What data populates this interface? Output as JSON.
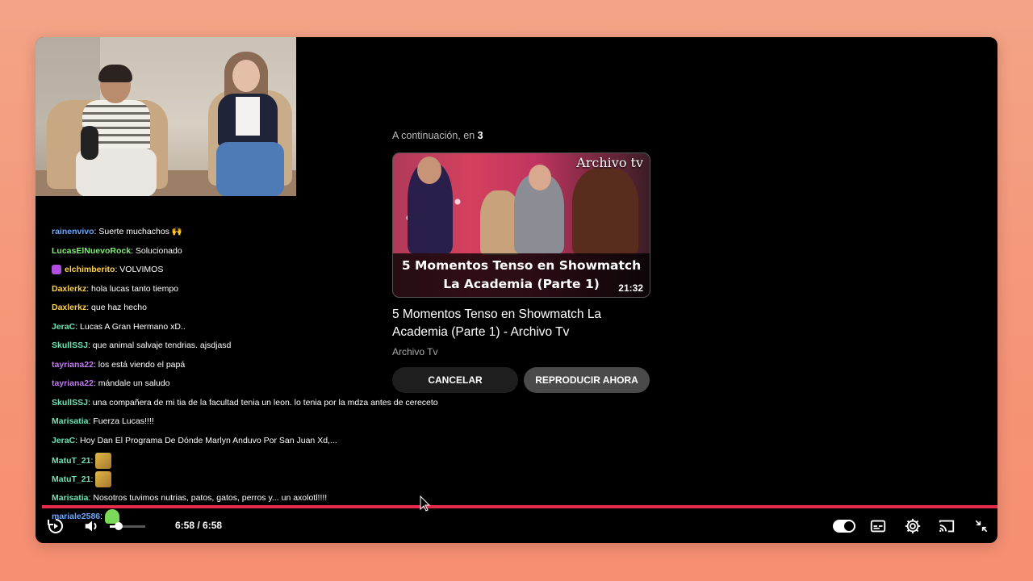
{
  "chat": [
    {
      "user": "rainenvivo",
      "color": "#6aa8ff",
      "msg": ": Suerte muchachos 🙌"
    },
    {
      "user": "LucasElNuevoRock",
      "color": "#7cf070",
      "msg": ": Solucionado"
    },
    {
      "user": "elchimberito",
      "color": "#ffd24d",
      "msg": ": VOLVIMOS",
      "badge": "mic"
    },
    {
      "user": "Daxlerkz",
      "color": "#ffd24d",
      "msg": ": hola lucas tanto tiempo"
    },
    {
      "user": "Daxlerkz",
      "color": "#ffd24d",
      "msg": ": que haz hecho"
    },
    {
      "user": "JeraC",
      "color": "#6fe3b2",
      "msg": ": Lucas A Gran Hermano xD.."
    },
    {
      "user": "SkullSSJ",
      "color": "#6fe3b2",
      "msg": ": que animal salvaje tendrias. ajsdjasd"
    },
    {
      "user": "tayriana22",
      "color": "#c07cf0",
      "msg": ": los está viendo el papá"
    },
    {
      "user": "tayriana22",
      "color": "#c07cf0",
      "msg": ": mándale un saludo"
    },
    {
      "user": "SkullSSJ",
      "color": "#6fe3b2",
      "msg": ": una compañera de mi tia de la facultad tenia un leon. lo tenia por la mdza antes de cereceto"
    },
    {
      "user": "Marisatia",
      "color": "#6fe3b2",
      "msg": ": Fuerza Lucas!!!!"
    },
    {
      "user": "JeraC",
      "color": "#6fe3b2",
      "msg": ": Hoy Dan El Programa De Dónde Marlyn Anduvo Por San Juan Xd,..."
    },
    {
      "user": "MatuT_21",
      "color": "#6fe3b2",
      "msg": ":",
      "emote": "gold"
    },
    {
      "user": "MatuT_21",
      "color": "#6fe3b2",
      "msg": ":",
      "emote": "gold"
    },
    {
      "user": "Marisatia",
      "color": "#6fe3b2",
      "msg": ": Nosotros tuvimos nutrias, patos, gatos, perros y... un axolotl!!!!"
    },
    {
      "user": "mariale2586",
      "color": "#6aa8ff",
      "msg": ":",
      "emote": "green"
    }
  ],
  "upnext": {
    "label_prefix": "A continuación, en",
    "countdown": "3",
    "thumb_caption_line1": "5 Momentos Tenso en Showmatch",
    "thumb_caption_line2": "La Academia (Parte 1)",
    "thumb_brand": "Archivo tv",
    "duration": "21:32",
    "title": "5 Momentos Tenso en Showmatch La Academia (Parte 1) - Archivo Tv",
    "channel": "Archivo Tv",
    "cancel_label": "CANCELAR",
    "play_label": "REPRODUCIR AHORA"
  },
  "player": {
    "time": "6:58 / 6:58",
    "progress_fraction": 1.0,
    "volume_fraction": 0.25,
    "autoplay_on": true,
    "progress_color": "#e4294b"
  },
  "icons": {
    "replay": "replay-icon",
    "volume": "volume-icon",
    "autoplay": "autoplay-toggle-icon",
    "subtitles": "subtitles-icon",
    "settings": "gear-icon",
    "cast": "cast-icon",
    "exit_fullscreen": "exit-fullscreen-icon"
  }
}
